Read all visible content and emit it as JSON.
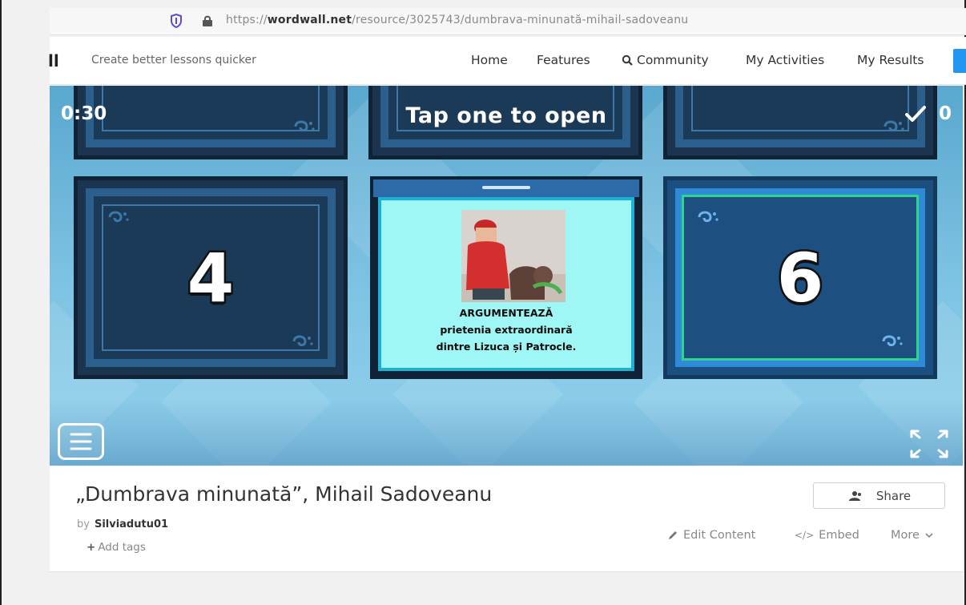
{
  "browser": {
    "url_prefix": "https://",
    "url_domain": "wordwall.net",
    "url_path": "/resource/3025743/dumbrava-minunată-mihail-sadoveanu"
  },
  "site": {
    "logo": "ll",
    "tagline": "Create better lessons quicker",
    "nav": [
      "Home",
      "Features",
      "Community",
      "My Activities",
      "My Results"
    ]
  },
  "game": {
    "timer": "0:30",
    "prompt": "Tap one to open",
    "score": "0",
    "tiles": [
      {
        "number": "4"
      },
      {
        "number": "6"
      }
    ],
    "open_card": {
      "line1": "ARGUMENTEAZĂ",
      "line2": "prietenia extraordinară",
      "line3": "dintre Lizuca și Patrocle."
    }
  },
  "activity": {
    "title": "„Dumbrava minunată”, Mihail Sadoveanu",
    "by_label": "by",
    "author": "Silviadutu01",
    "add_tags": "Add tags",
    "share": "Share",
    "edit_content": "Edit Content",
    "embed": "Embed",
    "more": "More"
  },
  "colors": {
    "accent_blue": "#2196f3",
    "tile_dark": "#1a3a58",
    "card_face": "#9ff7f5",
    "selected_border": "#2fd58a"
  }
}
